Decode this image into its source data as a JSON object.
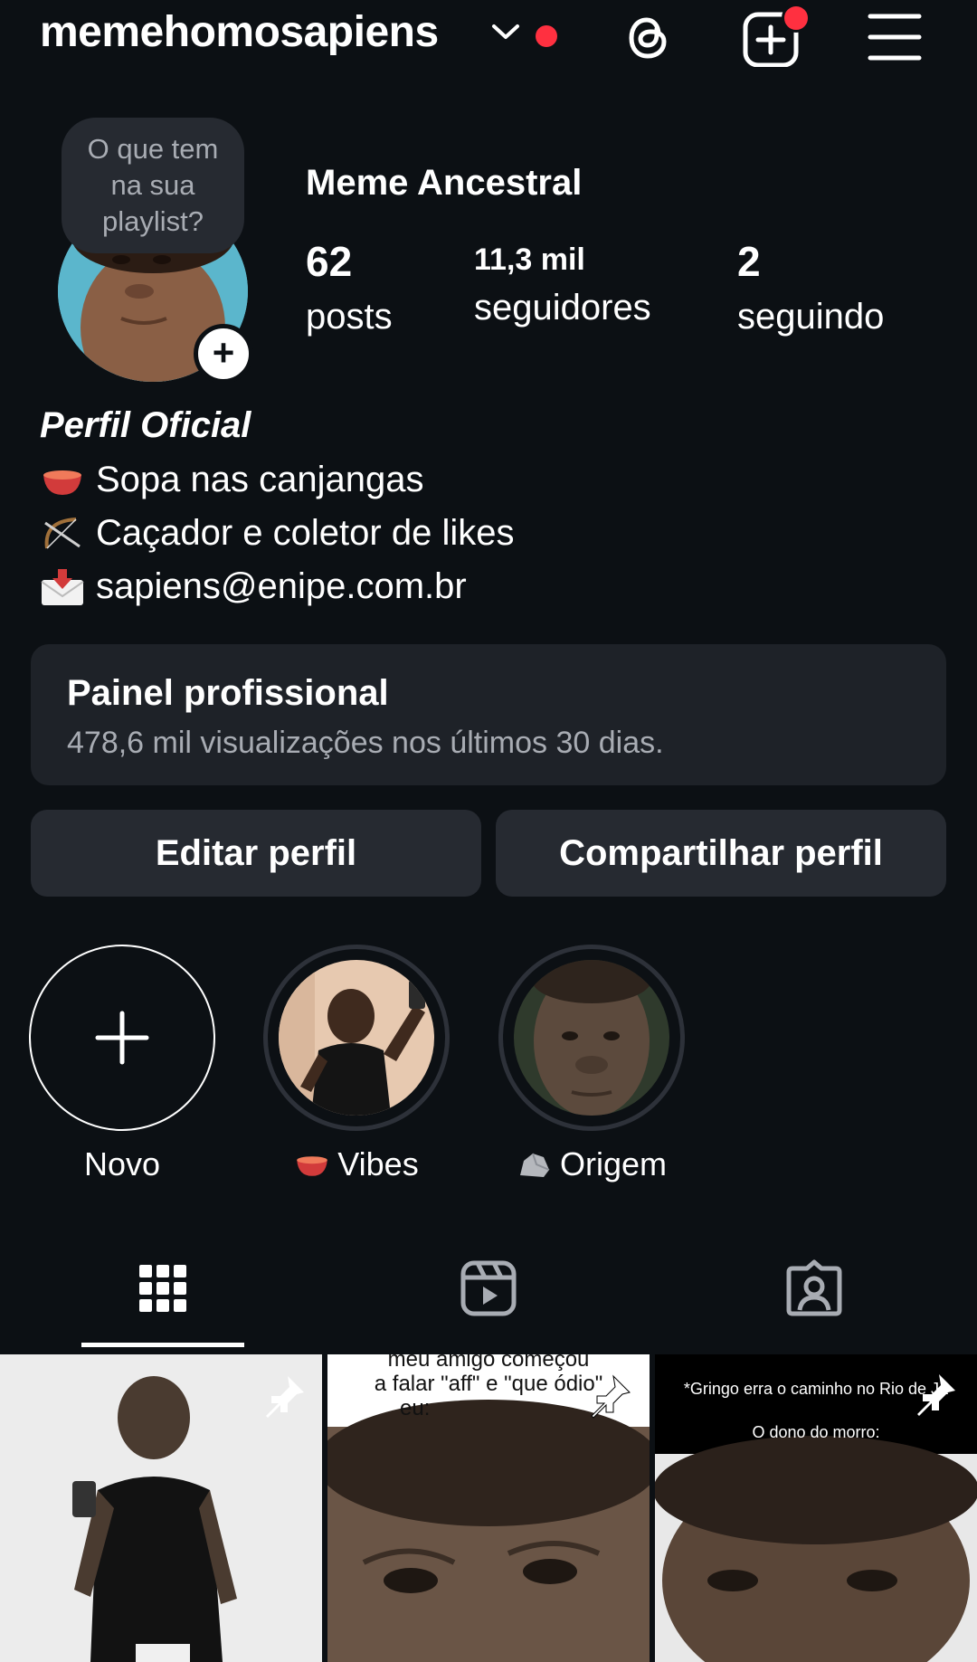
{
  "header": {
    "username": "memehomosapiens",
    "icons": [
      "chevron-down-icon",
      "threads-icon",
      "new-post-icon",
      "menu-icon"
    ]
  },
  "profile": {
    "note": "O que tem na sua playlist?",
    "display_name": "Meme Ancestral",
    "stats": {
      "posts": {
        "value": "62",
        "label": "posts"
      },
      "followers": {
        "value": "11,3 mil",
        "label": "seguidores"
      },
      "following": {
        "value": "2",
        "label": "seguindo"
      }
    }
  },
  "bio": {
    "title": "Perfil Oficial",
    "lines": [
      {
        "icon": "bowl-icon",
        "text": "Sopa nas canjangas"
      },
      {
        "icon": "bow-arrow-icon",
        "text": "Caçador e coletor de likes"
      },
      {
        "icon": "envelope-icon",
        "text": "sapiens@enipe.com.br"
      }
    ]
  },
  "panel": {
    "title": "Painel profissional",
    "subtitle": "478,6 mil visualizações nos últimos 30 dias."
  },
  "buttons": {
    "edit": "Editar perfil",
    "share": "Compartilhar perfil"
  },
  "highlights": [
    {
      "label": "Novo",
      "icon": "plus-icon"
    },
    {
      "label": "Vibes",
      "icon": "bowl-icon"
    },
    {
      "label": "Origem",
      "icon": "rock-icon"
    }
  ],
  "tabs": [
    {
      "name": "grid",
      "icon": "grid-icon",
      "active": true
    },
    {
      "name": "reels",
      "icon": "reels-icon",
      "active": false
    },
    {
      "name": "tagged",
      "icon": "tagged-user-icon",
      "active": false
    }
  ],
  "posts": [
    {
      "caption": "",
      "pinned": true
    },
    {
      "caption_line1": "meu amigo começou",
      "caption_line2": "a falar \"aff\" e \"que ódio\"",
      "caption_line3": "eu:",
      "pinned": true
    },
    {
      "caption_line1": "*Gringo erra o caminho no Rio de Ja",
      "caption_line2": "O dono do morro:",
      "pinned": true
    }
  ],
  "colors": {
    "background": "#0c1014",
    "surface": "#262a31",
    "panel": "#1e2228",
    "secondary_text": "#a8acb3",
    "notification": "#ff3040"
  }
}
